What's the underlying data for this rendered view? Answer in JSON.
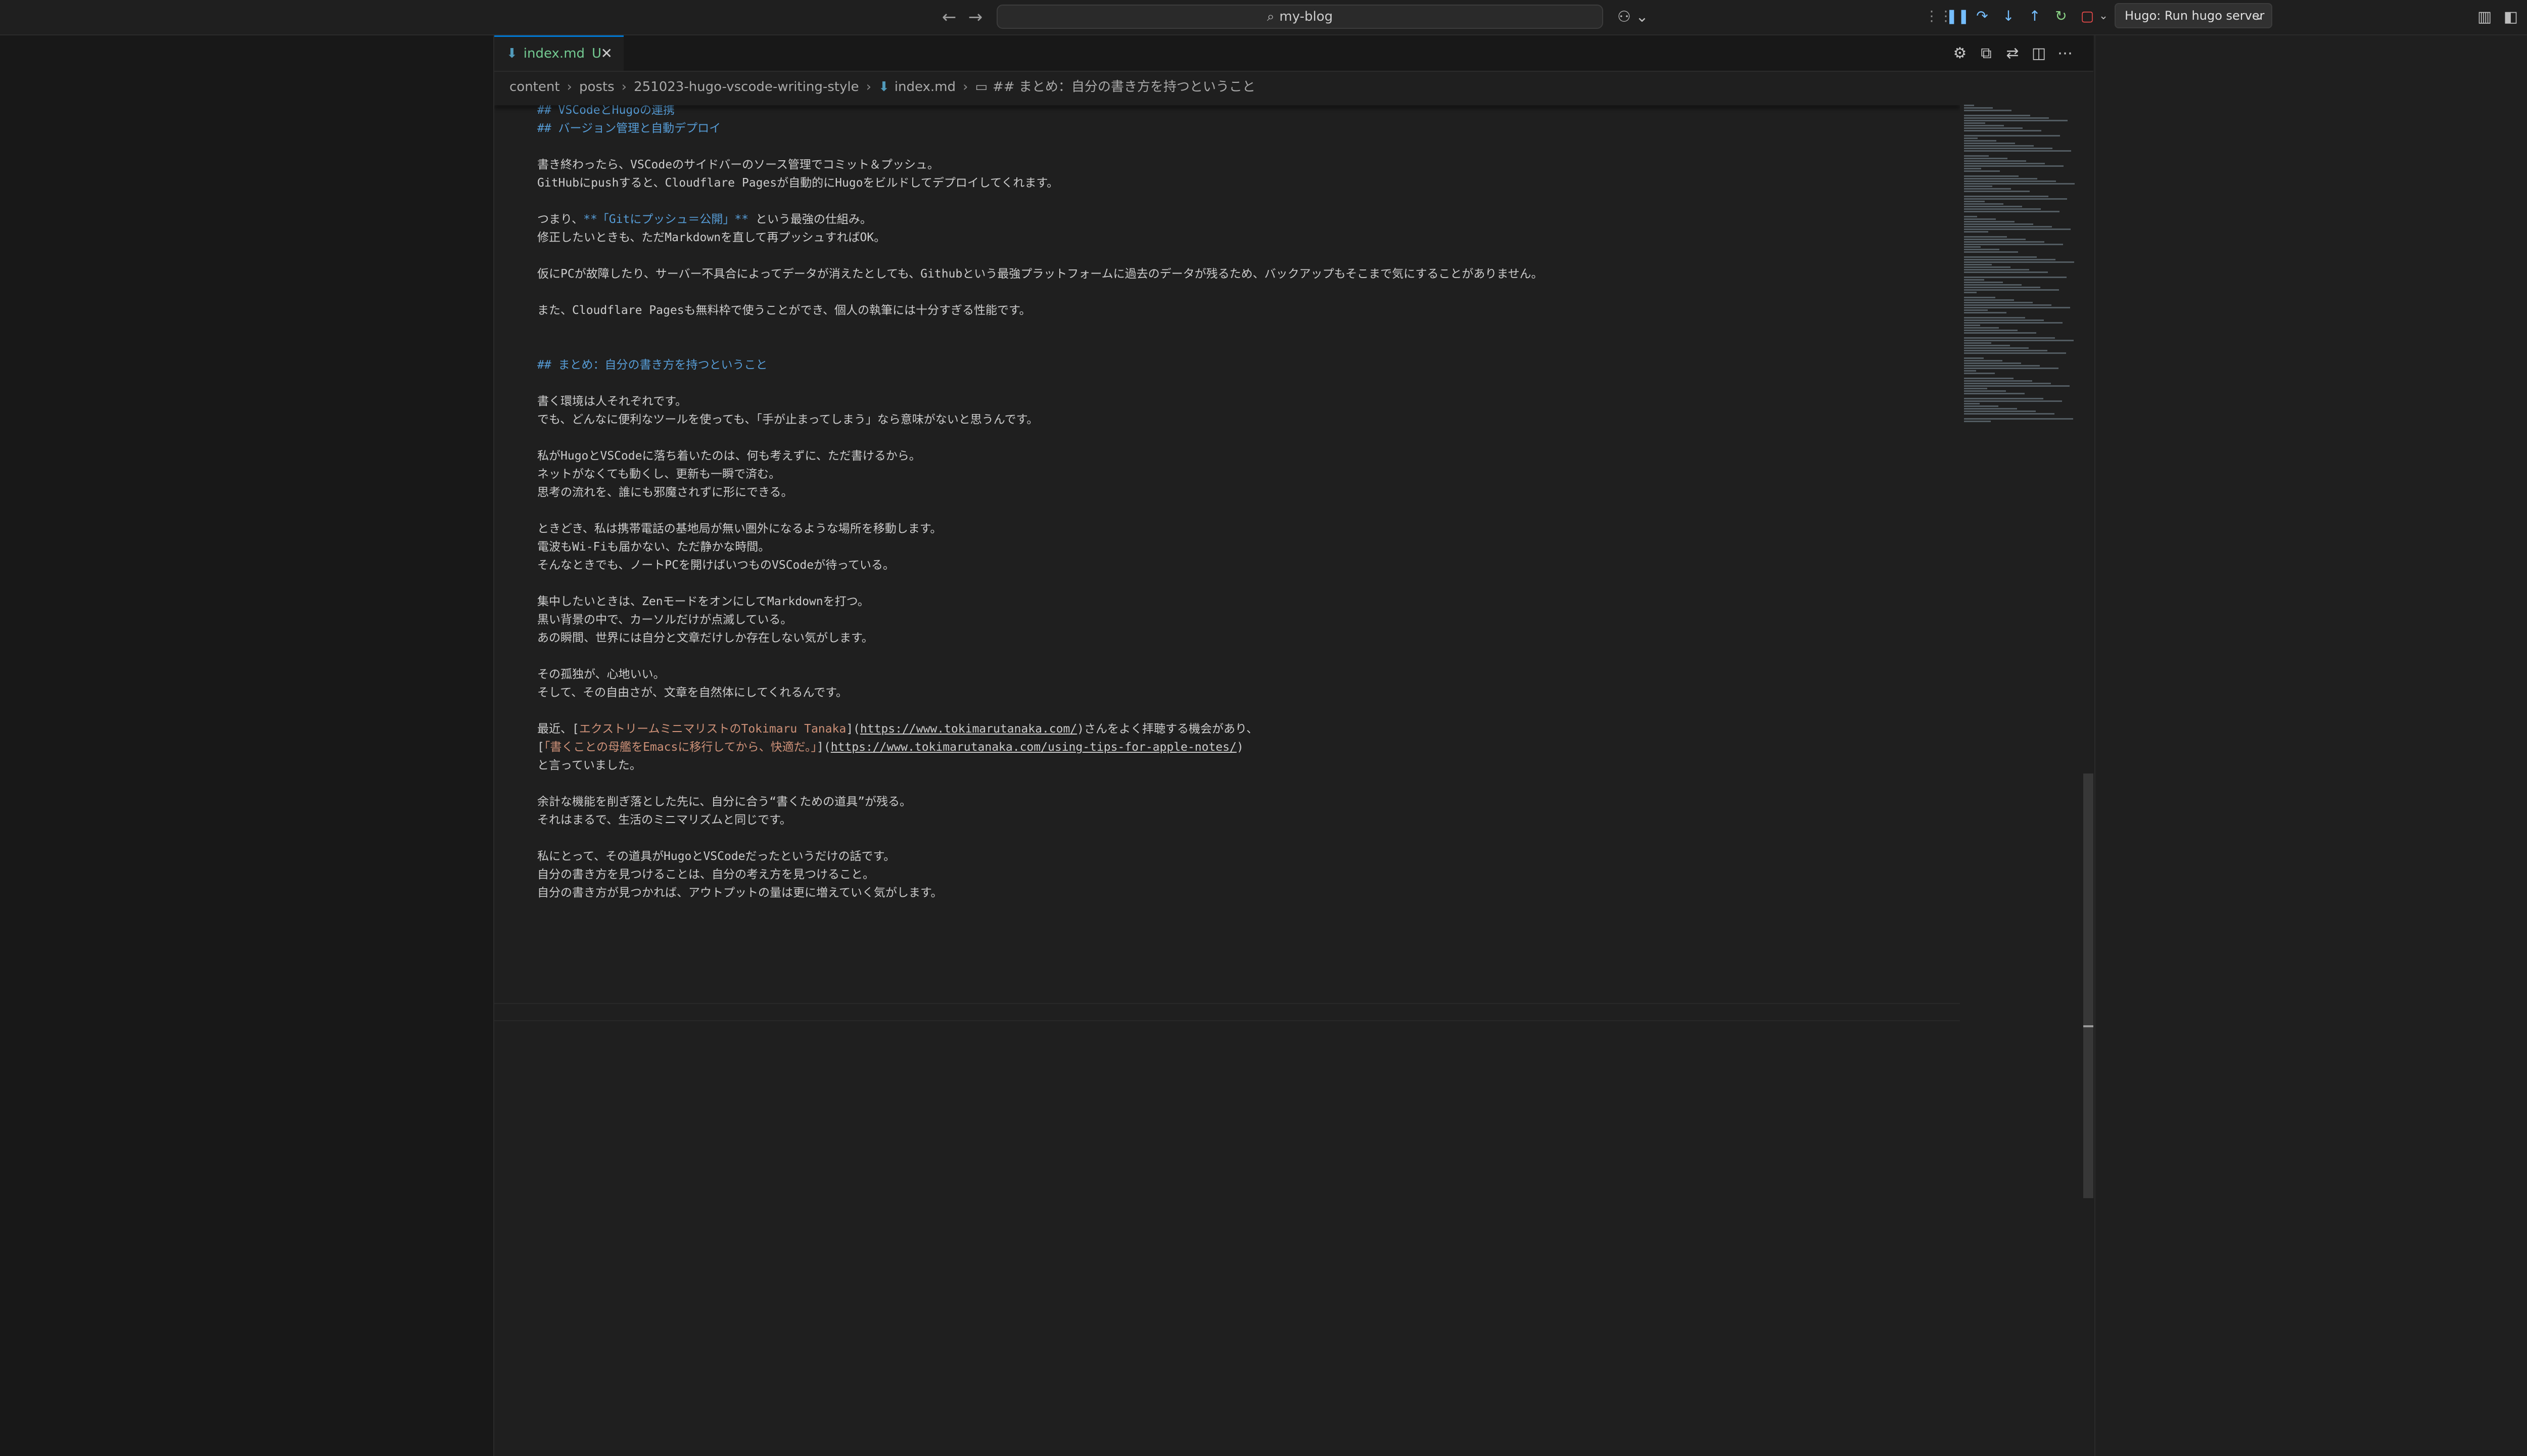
{
  "titlebar": {
    "search_text": "my-blog",
    "back_icon": "arrow-left-icon",
    "forward_icon": "arrow-right-icon",
    "task_label": "Hugo: Run hugo server",
    "colors": {
      "debug_stop": "#f14c4c",
      "debug_restart": "#89d185",
      "debug_pause": "#75beff"
    }
  },
  "tab": {
    "label": "index.md",
    "status": "U",
    "close": "✕"
  },
  "breadcrumb": {
    "items": [
      "content",
      "posts",
      "251023-hugo-vscode-writing-style",
      "index.md",
      "## まとめ：自分の書き方を持つということ"
    ]
  },
  "editor": {
    "lines": [
      {
        "t": "## VSCodeとHugoの連携",
        "k": "h"
      },
      {
        "t": "## バージョン管理と自動デプロイ",
        "k": "h"
      },
      {
        "t": "",
        "k": ""
      },
      {
        "t": "書き終わったら、VSCodeのサイドバーのソース管理でコミット＆プッシュ。",
        "k": ""
      },
      {
        "t": "GitHubにpushすると、Cloudflare Pagesが自動的にHugoをビルドしてデプロイしてくれます。",
        "k": ""
      },
      {
        "t": "",
        "k": ""
      },
      {
        "t": "つまり、",
        "k": "",
        "b": "**「Gitにプッシュ＝公開」**",
        "r": " という最強の仕組み。"
      },
      {
        "t": "修正したいときも、ただMarkdownを直して再プッシュすればOK。",
        "k": ""
      },
      {
        "t": "",
        "k": ""
      },
      {
        "t": "仮にPCが故障したり、サーバー不具合によってデータが消えたとしても、Githubという最強プラットフォームに過去のデータが残るため、バックアップもそこまで気にすることがありません。",
        "k": ""
      },
      {
        "t": "",
        "k": ""
      },
      {
        "t": "また、Cloudflare Pagesも無料枠で使うことができ、個人の執筆には十分すぎる性能です。",
        "k": ""
      },
      {
        "t": "",
        "k": ""
      },
      {
        "t": "",
        "k": ""
      },
      {
        "t": "## まとめ：自分の書き方を持つということ",
        "k": "h"
      },
      {
        "t": "",
        "k": ""
      },
      {
        "t": "書く環境は人それぞれです。",
        "k": ""
      },
      {
        "t": "でも、どんなに便利なツールを使っても、「手が止まってしまう」なら意味がないと思うんです。",
        "k": ""
      },
      {
        "t": "",
        "k": ""
      },
      {
        "t": "私がHugoとVSCodeに落ち着いたのは、何も考えずに、ただ書けるから。",
        "k": ""
      },
      {
        "t": "ネットがなくても動くし、更新も一瞬で済む。",
        "k": ""
      },
      {
        "t": "思考の流れを、誰にも邪魔されずに形にできる。",
        "k": ""
      },
      {
        "t": "",
        "k": ""
      },
      {
        "t": "ときどき、私は携帯電話の基地局が無い圏外になるような場所を移動します。",
        "k": ""
      },
      {
        "t": "電波もWi-Fiも届かない、ただ静かな時間。",
        "k": ""
      },
      {
        "t": "そんなときでも、ノートPCを開けばいつものVSCodeが待っている。",
        "k": ""
      },
      {
        "t": "",
        "k": ""
      },
      {
        "t": "集中したいときは、ZenモードをオンにしてMarkdownを打つ。",
        "k": ""
      },
      {
        "t": "黒い背景の中で、カーソルだけが点滅している。",
        "k": ""
      },
      {
        "t": "あの瞬間、世界には自分と文章だけしか存在しない気がします。",
        "k": ""
      },
      {
        "t": "",
        "k": ""
      },
      {
        "t": "その孤独が、心地いい。",
        "k": ""
      },
      {
        "t": "そして、その自由さが、文章を自然体にしてくれるんです。",
        "k": ""
      },
      {
        "t": "",
        "k": ""
      },
      {
        "t": "最近、[",
        "k": "",
        "l": "エクストリームミニマリストのTokimaru Tanaka",
        "m": "](",
        "u": "https://www.tokimarutanaka.com/",
        "e": ")さんをよく拝聴する機会があり、"
      },
      {
        "t": "[",
        "k": "",
        "l": "「書くことの母艦をEmacsに移行してから、快適だ。」",
        "m": "](",
        "u": "https://www.tokimarutanaka.com/using-tips-for-apple-notes/",
        "e": ")"
      },
      {
        "t": "と言っていました。",
        "k": ""
      },
      {
        "t": "",
        "k": ""
      },
      {
        "t": "余計な機能を削ぎ落とした先に、自分に合う“書くための道具”が残る。",
        "k": ""
      },
      {
        "t": "それはまるで、生活のミニマリズムと同じです。",
        "k": ""
      },
      {
        "t": "",
        "k": ""
      },
      {
        "t": "私にとって、その道具がHugoとVSCodeだったというだけの話です。",
        "k": ""
      },
      {
        "t": "自分の書き方を見つけることは、自分の考え方を見つけること。",
        "k": ""
      },
      {
        "t": "自分の書き方が見つかれば、アウトプットの量は更に増えていく気がします。",
        "k": ""
      }
    ]
  }
}
